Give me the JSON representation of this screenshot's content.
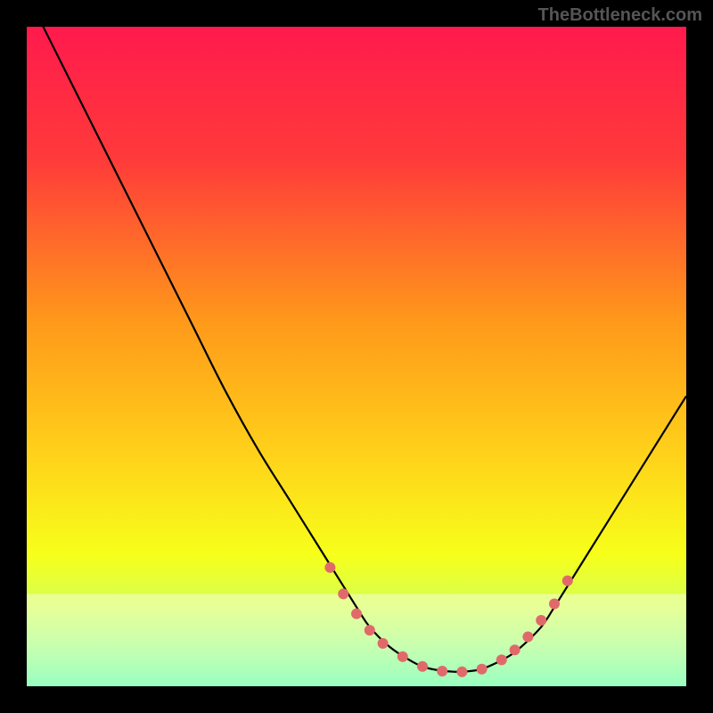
{
  "watermark": "TheBottleneck.com",
  "chart_data": {
    "type": "line",
    "title": "",
    "xlabel": "",
    "ylabel": "",
    "xlim": [
      0,
      100
    ],
    "ylim": [
      0,
      100
    ],
    "series": [
      {
        "name": "curve",
        "x": [
          0,
          5,
          10,
          15,
          20,
          25,
          30,
          35,
          40,
          45,
          50,
          52,
          55,
          58,
          60,
          62,
          65,
          68,
          70,
          73,
          75,
          78,
          80,
          85,
          90,
          95,
          100
        ],
        "y": [
          105,
          95,
          85,
          75,
          65,
          55,
          45,
          36,
          28,
          20,
          12,
          9,
          6,
          4,
          3,
          2.5,
          2.2,
          2.4,
          3,
          4.5,
          6,
          9,
          12,
          20,
          28,
          36,
          44
        ]
      }
    ],
    "markers": {
      "name": "dots",
      "x": [
        46,
        48,
        50,
        52,
        54,
        57,
        60,
        63,
        66,
        69,
        72,
        74,
        76,
        78,
        80,
        82
      ],
      "y": [
        18,
        14,
        11,
        8.5,
        6.5,
        4.5,
        3,
        2.3,
        2.2,
        2.6,
        4,
        5.5,
        7.5,
        10,
        12.5,
        16
      ]
    },
    "gradient_stops": [
      {
        "offset": 0,
        "color": "#ff1a4d"
      },
      {
        "offset": 0.2,
        "color": "#ff3a3a"
      },
      {
        "offset": 0.45,
        "color": "#ff9a1a"
      },
      {
        "offset": 0.65,
        "color": "#ffd21a"
      },
      {
        "offset": 0.8,
        "color": "#f7ff1a"
      },
      {
        "offset": 0.88,
        "color": "#d4ff55"
      },
      {
        "offset": 0.94,
        "color": "#8fff8a"
      },
      {
        "offset": 1.0,
        "color": "#2affb0"
      }
    ],
    "band_top_y": 14,
    "curve_color": "#000000",
    "marker_color": "#e06a6a",
    "marker_radius": 6
  }
}
